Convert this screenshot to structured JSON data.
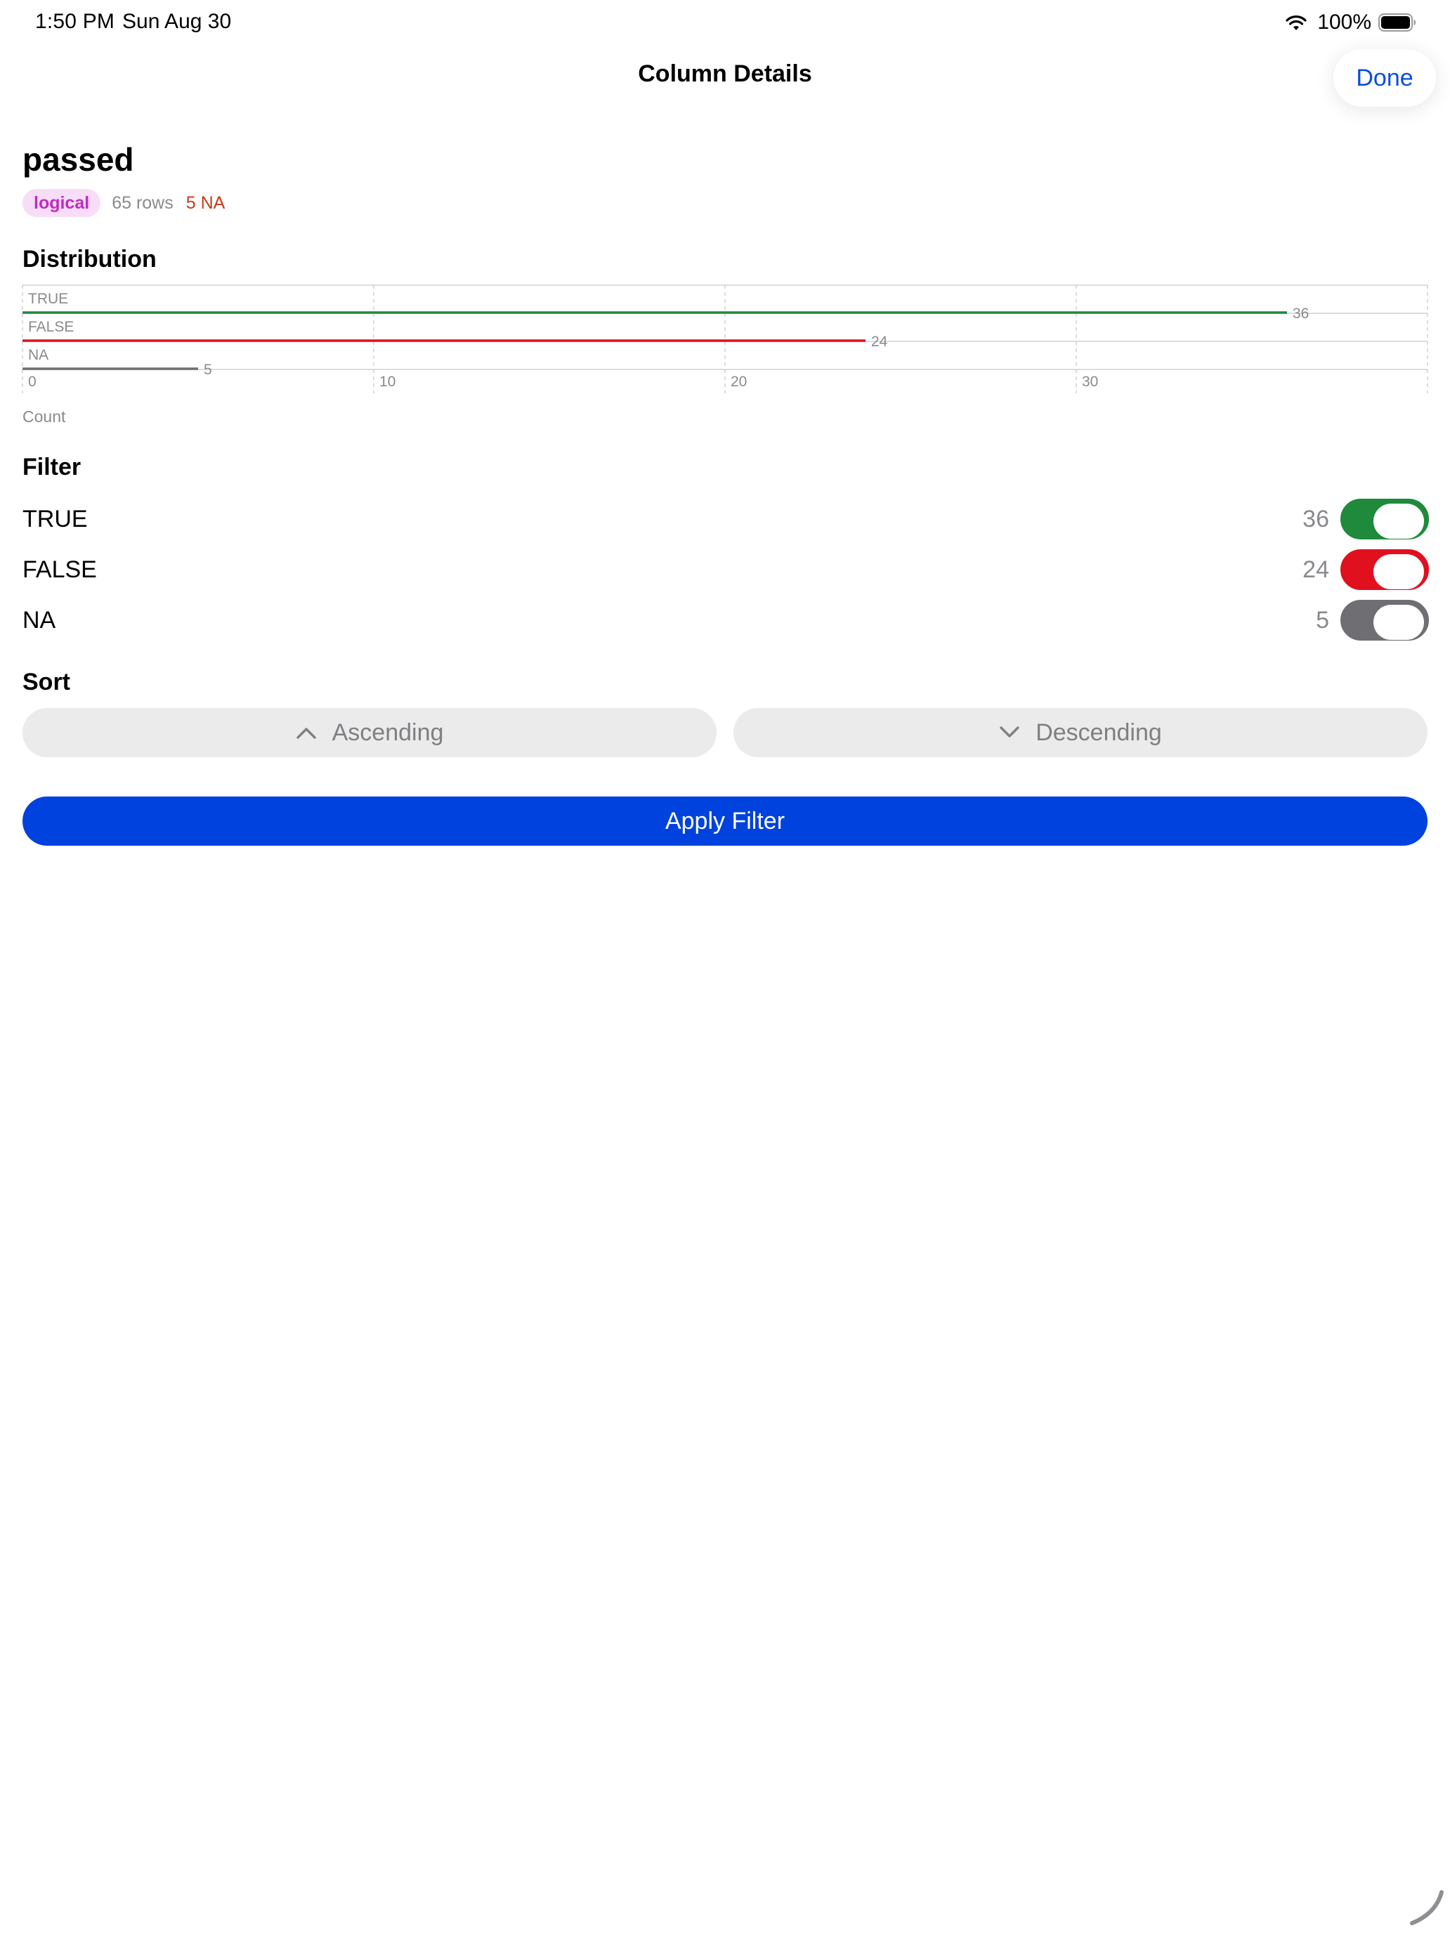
{
  "status_bar": {
    "time": "1:50 PM",
    "date": "Sun Aug 30",
    "battery_percent": "100%",
    "wifi_icon": "wifi-icon",
    "battery_icon": "battery-full-icon"
  },
  "nav": {
    "title": "Column Details",
    "done_label": "Done"
  },
  "column": {
    "name": "passed",
    "type_badge": "logical",
    "rows_text": "65 rows",
    "na_text": "5 NA"
  },
  "colors": {
    "true": "#1f8a3b",
    "false": "#e0101e",
    "na": "#6e6e73",
    "accent": "#0042dd",
    "done_text": "#0a4ee0",
    "badge_bg": "#f7ddf5",
    "badge_text": "#c22bc0",
    "na_text": "#c83a17"
  },
  "distribution": {
    "title": "Distribution",
    "x_axis_label": "Count"
  },
  "chart_data": {
    "type": "bar",
    "orientation": "horizontal",
    "categories": [
      "TRUE",
      "FALSE",
      "NA"
    ],
    "values": [
      36,
      24,
      5
    ],
    "colors": [
      "#1f8a3b",
      "#e0101e",
      "#6e6e73"
    ],
    "xlabel": "Count",
    "x_ticks": [
      0,
      10,
      20,
      30
    ],
    "xlim": [
      0,
      40
    ],
    "grid": true
  },
  "filter": {
    "title": "Filter",
    "items": [
      {
        "label": "TRUE",
        "count": "36",
        "enabled": true,
        "color": "#1f8a3b"
      },
      {
        "label": "FALSE",
        "count": "24",
        "enabled": true,
        "color": "#e0101e"
      },
      {
        "label": "NA",
        "count": "5",
        "enabled": true,
        "color": "#6e6e73"
      }
    ]
  },
  "sort": {
    "title": "Sort",
    "ascending_label": "Ascending",
    "descending_label": "Descending",
    "ascending_icon": "chevron-up-icon",
    "descending_icon": "chevron-down-icon"
  },
  "apply_label": "Apply Filter"
}
